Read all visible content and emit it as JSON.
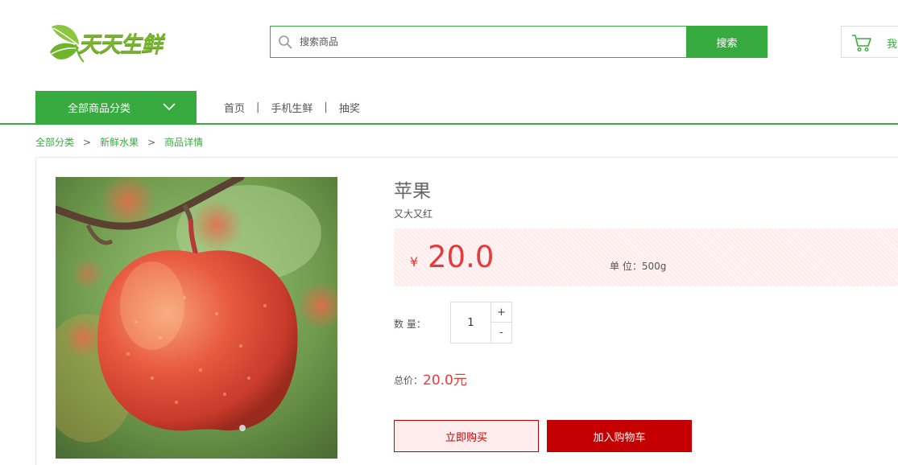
{
  "header": {
    "logo_text": "天天生鲜",
    "search": {
      "placeholder": "搜索商品",
      "button_label": "搜索"
    },
    "cart_label": "我"
  },
  "nav": {
    "all_categories": "全部商品分类",
    "links": [
      {
        "label": "首页"
      },
      {
        "label": "手机生鲜"
      },
      {
        "label": "抽奖"
      }
    ],
    "separator": "|"
  },
  "breadcrumb": {
    "items": [
      "全部分类",
      "新鲜水果",
      "商品详情"
    ],
    "arrow": ">"
  },
  "product": {
    "name": "苹果",
    "subtitle": "又大又红",
    "currency_symbol": "¥",
    "price": "20.0",
    "unit": "单 位：500g",
    "quantity_label": "数 量：",
    "quantity": "1",
    "plus": "+",
    "minus": "-",
    "total_label": "总价：",
    "total_value": "20.0元",
    "buy_now_label": "立即购买",
    "add_to_cart_label": "加入购物车",
    "image": "apple-photo"
  },
  "colors": {
    "brand_green": "#37ab40",
    "price_red": "#e53b3b",
    "button_red": "#c40000"
  }
}
